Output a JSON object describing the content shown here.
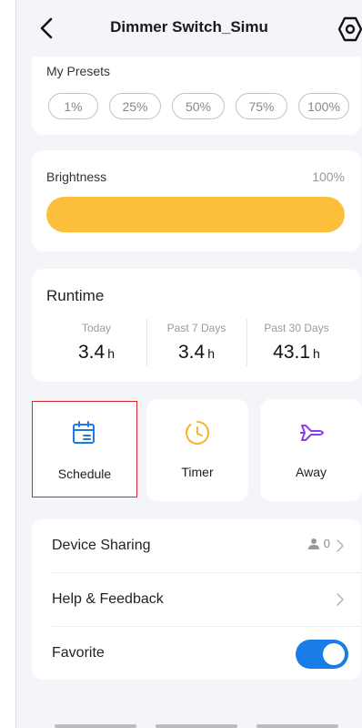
{
  "header": {
    "title": "Dimmer Switch_Simu"
  },
  "presets": {
    "title": "My Presets",
    "items": [
      "1%",
      "25%",
      "50%",
      "75%",
      "100%"
    ]
  },
  "brightness": {
    "title": "Brightness",
    "value_label": "100%",
    "level": 1.0,
    "color": "#fcbf3a"
  },
  "runtime": {
    "title": "Runtime",
    "columns": [
      {
        "label": "Today",
        "value": "3.4",
        "unit": "h"
      },
      {
        "label": "Past 7 Days",
        "value": "3.4",
        "unit": "h"
      },
      {
        "label": "Past 30 Days",
        "value": "43.1",
        "unit": "h"
      }
    ]
  },
  "tiles": [
    {
      "label": "Schedule",
      "icon": "calendar-icon",
      "color": "#1f7ae0"
    },
    {
      "label": "Timer",
      "icon": "clock-icon",
      "color": "#f7b42c"
    },
    {
      "label": "Away",
      "icon": "airplane-icon",
      "color": "#8b3fe0"
    }
  ],
  "settings": {
    "device_sharing": {
      "label": "Device Sharing",
      "count": "0"
    },
    "help": {
      "label": "Help & Feedback"
    },
    "favorite": {
      "label": "Favorite",
      "on": true,
      "color": "#1a7ce6"
    }
  }
}
